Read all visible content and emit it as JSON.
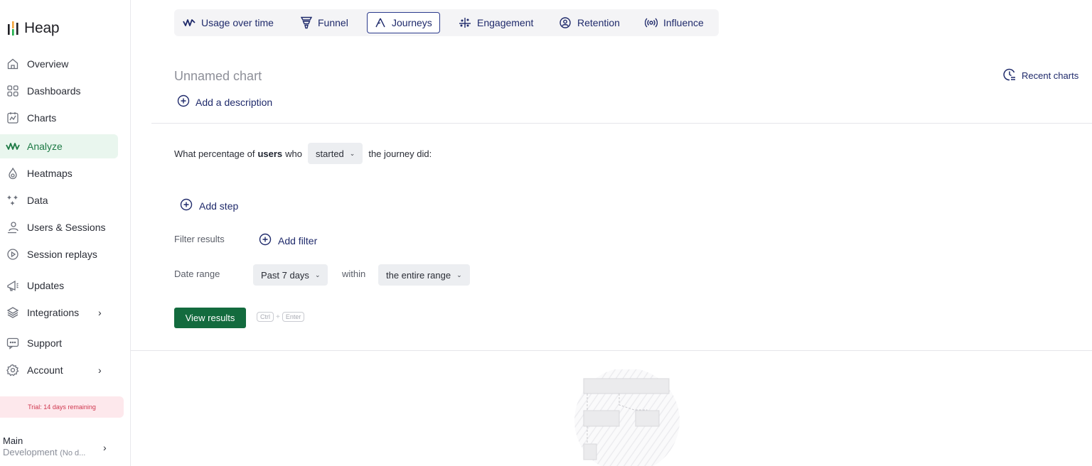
{
  "app": {
    "name": "Heap"
  },
  "sidebar": {
    "items": [
      {
        "label": "Overview",
        "icon": "home-icon"
      },
      {
        "label": "Dashboards",
        "icon": "grid-icon"
      },
      {
        "label": "Charts",
        "icon": "chart-icon"
      },
      {
        "label": "Analyze",
        "icon": "analyze-icon",
        "active": true
      },
      {
        "label": "Heatmaps",
        "icon": "heatmap-icon"
      },
      {
        "label": "Data",
        "icon": "sparkle-icon"
      },
      {
        "label": "Users & Sessions",
        "icon": "users-icon"
      },
      {
        "label": "Session replays",
        "icon": "replay-icon"
      },
      {
        "label": "Updates",
        "icon": "megaphone-icon"
      },
      {
        "label": "Integrations",
        "icon": "layers-icon"
      },
      {
        "label": "Support",
        "icon": "chat-icon"
      },
      {
        "label": "Account",
        "icon": "gear-icon"
      }
    ],
    "trial_text": "Trial: 14 days remaining",
    "env": {
      "main": "Main",
      "sub": "Development",
      "sub_small": "(No d..."
    },
    "accent_color": "#1d7a45"
  },
  "tabs": [
    {
      "label": "Usage over time",
      "icon": "usage-icon"
    },
    {
      "label": "Funnel",
      "icon": "funnel-icon"
    },
    {
      "label": "Journeys",
      "icon": "journeys-icon",
      "active": true
    },
    {
      "label": "Engagement",
      "icon": "engagement-icon"
    },
    {
      "label": "Retention",
      "icon": "retention-icon"
    },
    {
      "label": "Influence",
      "icon": "influence-icon"
    }
  ],
  "chart": {
    "title": "Unnamed chart",
    "add_description": "Add a description",
    "recent_charts": "Recent charts"
  },
  "query": {
    "prefix": "What percentage of",
    "subject": "users",
    "who": "who",
    "event_mode": "started",
    "suffix": "the journey did:",
    "add_step": "Add step",
    "filter_label": "Filter results",
    "add_filter": "Add filter",
    "date_label": "Date range",
    "date_range": "Past 7 days",
    "within": "within",
    "within_range": "the entire range",
    "view_results": "View results",
    "shortcut": {
      "key1": "Ctrl",
      "plus": "+",
      "key2": "Enter"
    }
  }
}
